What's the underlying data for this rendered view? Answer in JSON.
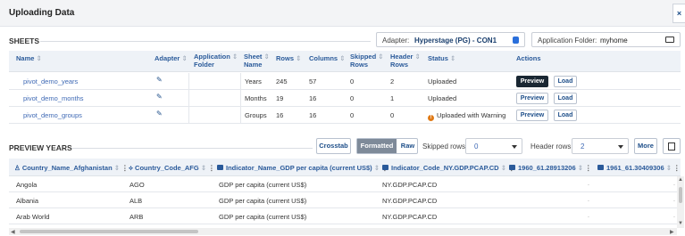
{
  "window": {
    "title": "Uploading Data",
    "close_label": "×"
  },
  "sheets": {
    "label": "SHEETS",
    "adapter": {
      "label": "Adapter:",
      "value": "Hyperstage (PG) - CON1",
      "icon": "database-icon"
    },
    "app_folder": {
      "label": "Application Folder:",
      "value": "myhome",
      "icon": "folder-icon"
    },
    "headers": {
      "name": "Name",
      "adapter": "Adapter",
      "app_folder_1": "Application",
      "app_folder_2": "Folder",
      "sheet_name_1": "Sheet",
      "sheet_name_2": "Name",
      "rows": "Rows",
      "columns": "Columns",
      "skipped_1": "Skipped",
      "skipped_2": "Rows",
      "header_1": "Header",
      "header_2": "Rows",
      "status": "Status",
      "actions": "Actions"
    },
    "rows": [
      {
        "name": "pivot_demo_years",
        "sheet": "Years",
        "rows": "245",
        "columns": "57",
        "skipped": "0",
        "header": "2",
        "status": "Uploaded",
        "preview": "Preview",
        "load": "Load"
      },
      {
        "name": "pivot_demo_months",
        "sheet": "Months",
        "rows": "19",
        "columns": "16",
        "skipped": "0",
        "header": "1",
        "status": "Uploaded",
        "preview": "Preview",
        "load": "Load"
      },
      {
        "name": "pivot_demo_groups",
        "sheet": "Groups",
        "rows": "16",
        "columns": "16",
        "skipped": "0",
        "header": "0",
        "status": "Uploaded with Warning",
        "preview": "Preview",
        "load": "Load"
      }
    ]
  },
  "preview": {
    "label": "PREVIEW YEARS",
    "crosstab": "Crosstab",
    "formatted": "Formatted",
    "raw": "Raw",
    "skipped_rows_label": "Skipped rows:",
    "skipped_rows_value": "0",
    "header_rows_label": "Header rows:",
    "header_rows_value": "2",
    "more": "More",
    "columns": [
      "Country_Name_Afghanistan",
      "Country_Code_AFG",
      "Indicator_Name_GDP per capita (current US$)",
      "Indicator_Code_NY.GDP.PCAP.CD",
      "1960_61.28913206",
      "1961_61.30409306"
    ],
    "rows": [
      {
        "c1": "Angola",
        "c2": "AGO",
        "c3": "GDP per capita (current US$)",
        "c4": "NY.GDP.PCAP.CD",
        "c5": ".",
        "c6": "."
      },
      {
        "c1": "Albania",
        "c2": "ALB",
        "c3": "GDP per capita (current US$)",
        "c4": "NY.GDP.PCAP.CD",
        "c5": ".",
        "c6": "."
      },
      {
        "c1": "Arab World",
        "c2": "ARB",
        "c3": "GDP per capita (current US$)",
        "c4": "NY.GDP.PCAP.CD",
        "c5": ".",
        "c6": "."
      }
    ]
  },
  "colors": {
    "accent": "#1d4e89",
    "link": "#3f6ab5",
    "header_bg": "#eef2f7",
    "warning": "#e07a16",
    "dark_button": "#1a2733"
  }
}
